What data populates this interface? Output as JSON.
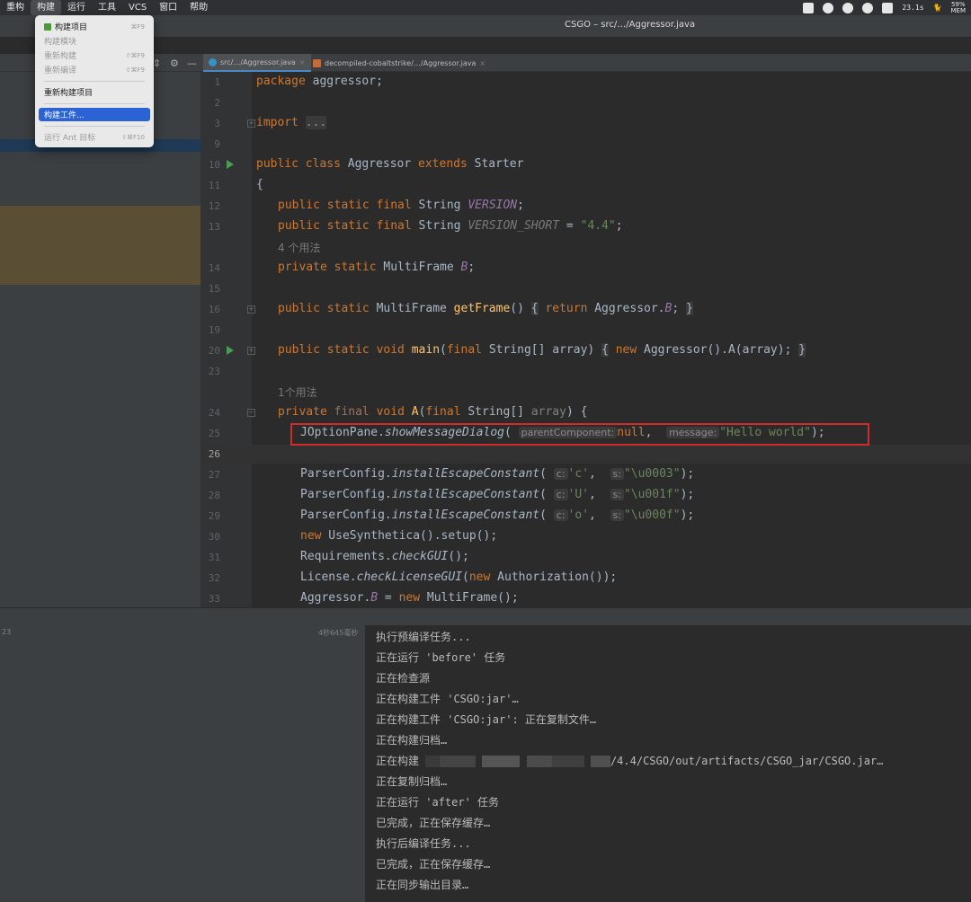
{
  "menubar": {
    "items": [
      "重构",
      "构建",
      "运行",
      "工具",
      "VCS",
      "窗口",
      "帮助"
    ],
    "tray": {
      "cpu": "23.1s",
      "battery_pct": "59%",
      "battery_label": "MEM"
    }
  },
  "window": {
    "title": "CSGO – src/…/Aggressor.java"
  },
  "tabs": [
    {
      "label": "src/…/Aggressor.java",
      "close": "×"
    },
    {
      "label": "decompiled-cobaltstrike/…/Aggressor.java",
      "close": "×"
    }
  ],
  "dropdown": {
    "items": [
      {
        "label": "构建项目",
        "shortcut": "⌘F9"
      },
      {
        "label": "构建模块",
        "shortcut": ""
      },
      {
        "label": "重新构建",
        "shortcut": "⇧⌘F9"
      },
      {
        "label": "重新编译",
        "shortcut": "⇧⌘F9"
      },
      {
        "label": "重新构建项目",
        "shortcut": ""
      },
      {
        "label": "构建工件...",
        "shortcut": ""
      },
      {
        "label": "运行 Ant 目标",
        "shortcut": "⇧⌘F10"
      }
    ]
  },
  "editor": {
    "line_numbers": [
      "1",
      "2",
      "3",
      "9",
      "10",
      "11",
      "12",
      "13",
      "14",
      "15",
      "16",
      "19",
      "20",
      "23",
      "24",
      "25",
      "26",
      "27",
      "28",
      "29",
      "30",
      "31",
      "32",
      "33"
    ],
    "usage_hints": [
      "4 个用法",
      "1个用法"
    ],
    "inlay_hints": [
      "parentComponent:",
      "message:",
      "c:",
      "s:"
    ],
    "highlight_note": "JOptionPane.showMessageDialog"
  },
  "build": {
    "tree_count": "23",
    "tree_time": "4秒645毫秒",
    "console": [
      "执行预编译任务...",
      "正在运行 'before' 任务",
      "正在检查源",
      "正在构建工件 'CSGO:jar'…",
      "正在构建工件 'CSGO:jar': 正在复制文件…",
      "正在构建归档…",
      "正在构建",
      "/4.4/CSGO/out/artifacts/CSGO_jar/CSGO.jar…",
      "正在复制归档…",
      "正在运行 'after' 任务",
      "已完成，正在保存缓存…",
      "执行后编译任务...",
      "已完成，正在保存缓存…",
      "正在同步输出目录…"
    ]
  }
}
